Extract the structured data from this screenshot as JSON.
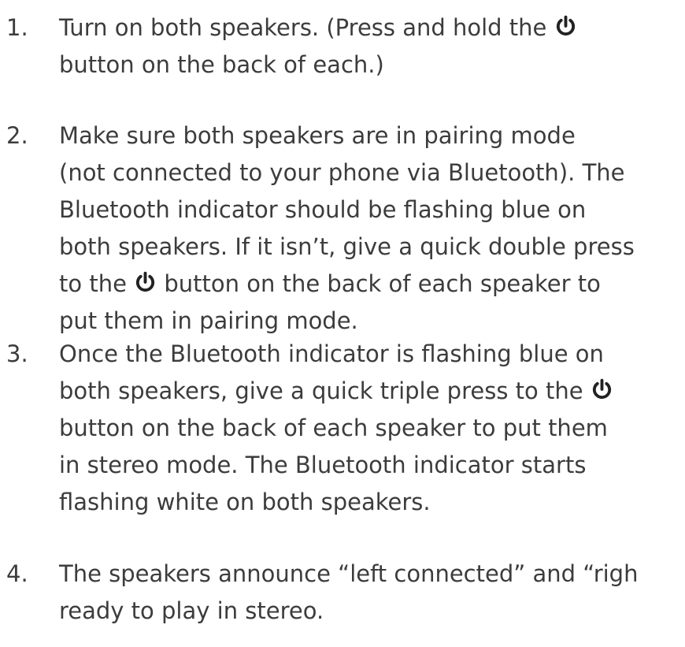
{
  "steps": [
    {
      "number": "1.",
      "lines": [
        [
          "Turn on both speakers. (Press and hold the ",
          "POWER",
          ""
        ],
        [
          "button on the back of each.)"
        ]
      ]
    },
    {
      "number": "2.",
      "lines": [
        [
          "Make sure both speakers are in pairing mode"
        ],
        [
          "(not connected to your phone via Bluetooth). The"
        ],
        [
          "Bluetooth indicator should be flashing blue on"
        ],
        [
          "both speakers. If it isn’t, give a quick double press"
        ],
        [
          "to the ",
          "POWER",
          " button on the back of each speaker to"
        ],
        [
          "put them in pairing mode."
        ]
      ]
    },
    {
      "number": "3.",
      "lines": [
        [
          "Once the Bluetooth indicator is flashing blue on"
        ],
        [
          "both speakers, give a quick triple press to the ",
          "POWER",
          ""
        ],
        [
          "button on the back of each speaker to put them"
        ],
        [
          "in stereo mode. The Bluetooth indicator starts"
        ],
        [
          "flashing white on both speakers."
        ]
      ]
    },
    {
      "number": "4.",
      "lines": [
        [
          "The speakers announce “left connected” and “righ"
        ],
        [
          "ready to play in stereo."
        ]
      ]
    }
  ],
  "icons": {
    "power": "power-icon"
  },
  "colors": {
    "text": "#3c3c3c",
    "icon": "#222222"
  }
}
